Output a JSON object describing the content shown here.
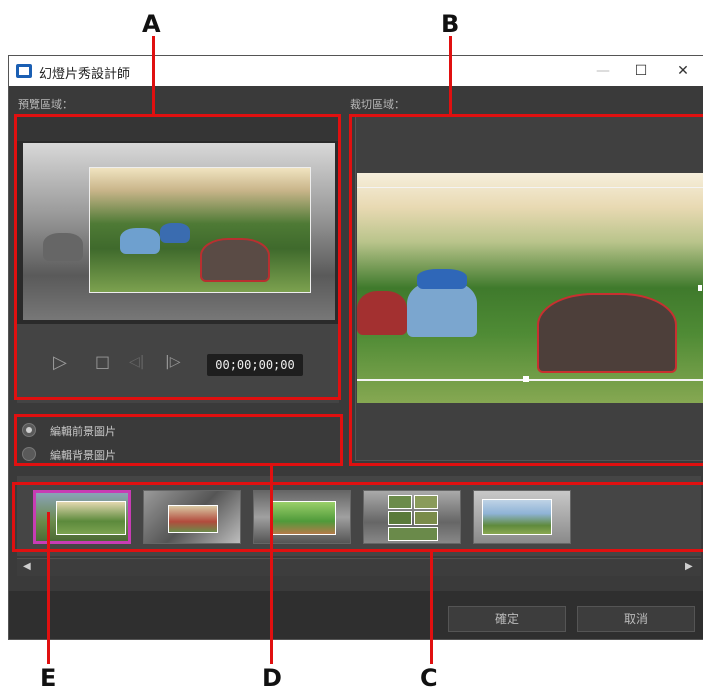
{
  "callouts": {
    "a": "A",
    "b": "B",
    "c": "C",
    "d": "D",
    "e": "E"
  },
  "window": {
    "title": "幻燈片秀設計師",
    "minimize": "—",
    "maximize": "☐",
    "close": "✕"
  },
  "preview": {
    "label": "預覽區域：",
    "timecode": "00;00;00;00",
    "play": "▷",
    "stop": "□",
    "prev_frame": "◁|",
    "next_frame": "|▷"
  },
  "crop": {
    "label": "裁切區域："
  },
  "options": {
    "foreground": "編輯前景圖片",
    "background": "編輯背景圖片",
    "selected": "foreground"
  },
  "thumbnails": [
    {
      "name": "thumb-1",
      "selected": true
    },
    {
      "name": "thumb-2",
      "selected": false
    },
    {
      "name": "thumb-3",
      "selected": false
    },
    {
      "name": "thumb-4",
      "selected": false
    },
    {
      "name": "thumb-5",
      "selected": false
    }
  ],
  "scroll": {
    "left": "◀",
    "right": "▶"
  },
  "footer": {
    "ok": "確定",
    "cancel": "取消"
  },
  "colors": {
    "callout_red": "#e01010",
    "selected_thumb": "#c83cb4",
    "window_bg": "#3a3a3a"
  }
}
